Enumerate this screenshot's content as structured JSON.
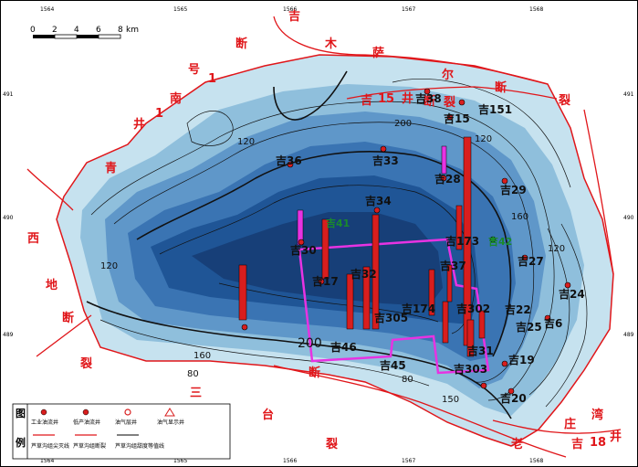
{
  "coord_labels": {
    "top": [
      "1564",
      "1565",
      "1566",
      "1567",
      "1568"
    ],
    "top_sub": "2000",
    "left": [
      "491",
      "490",
      "489"
    ],
    "left_sub": "2000"
  },
  "scale_bar": {
    "ticks": [
      "0",
      "2",
      "4",
      "6",
      "8"
    ],
    "unit": "km"
  },
  "fault_labels": [
    "吉",
    "木",
    "萨",
    "尔",
    "断",
    "裂",
    "吉",
    "15",
    "井",
    "断",
    "裂",
    "断",
    "1",
    "号",
    "南",
    "1",
    "井",
    "青",
    "西",
    "地",
    "断",
    "裂",
    "三",
    "台",
    "断",
    "裂",
    "老",
    "庄",
    "湾",
    "吉",
    "18",
    "井"
  ],
  "wells": [
    "吉38",
    "吉151",
    "吉15",
    "吉33",
    "吉36",
    "吉28",
    "吉29",
    "吉34",
    "吉30",
    "吉41",
    "吉42",
    "吉173",
    "吉27",
    "吉24",
    "吉37",
    "吉302",
    "吉174",
    "吉17",
    "吉22",
    "吉6",
    "吉25",
    "吉32",
    "吉305",
    "吉31",
    "吉303",
    "吉46",
    "吉45",
    "吉19",
    "吉20"
  ],
  "contour_labels": [
    "120",
    "120",
    "200",
    "200",
    "160",
    "120",
    "80",
    "160",
    "120",
    "150",
    "80"
  ],
  "legend": {
    "title_top": "图",
    "title_bottom": "例",
    "items": [
      "工业油流井",
      "低产油流井",
      "油气层井",
      "油气显示井",
      "芦草沟组尖灭线",
      "芦草沟组断裂",
      "芦草沟组甜度等值线"
    ]
  },
  "colors": {
    "deep": "#1b4e8a",
    "mid": "#3f7cba",
    "shallow": "#bfdcec",
    "fault": "#e0161a",
    "study_box": "#e733e2",
    "well_bar": "#d81e1e"
  }
}
